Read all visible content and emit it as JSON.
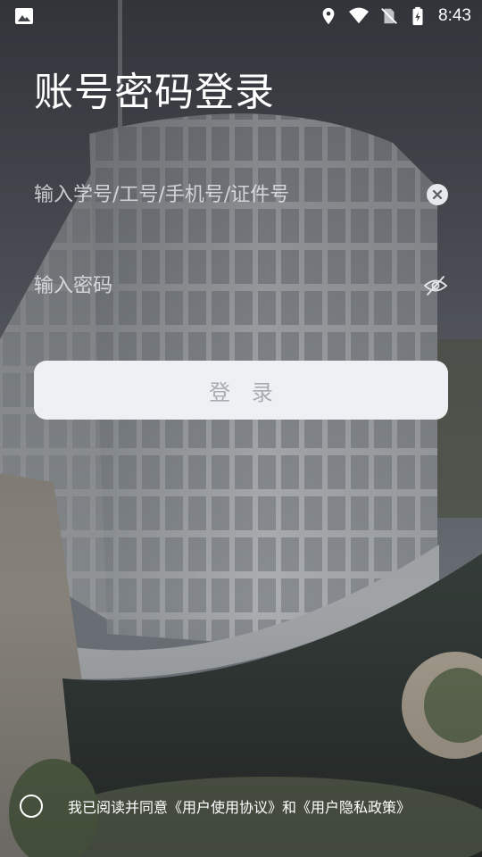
{
  "status_bar": {
    "time": "8:43",
    "icons": [
      "gallery-icon",
      "location-icon",
      "wifi-icon",
      "no-sim-icon",
      "battery-icon"
    ]
  },
  "login": {
    "title": "账号密码登录",
    "account_placeholder": "输入学号/工号/手机号/证件号",
    "account_value": "",
    "password_placeholder": "输入密码",
    "password_value": "",
    "submit_label": "登 录"
  },
  "agreement": {
    "prefix": "我已阅读并同意",
    "user_agreement": "《用户使用协议》",
    "connector": "和",
    "privacy_policy": "《用户隐私政策》"
  },
  "colors": {
    "button_bg": "#eff0f4",
    "button_text": "#a9abb3",
    "text": "#ffffff"
  }
}
